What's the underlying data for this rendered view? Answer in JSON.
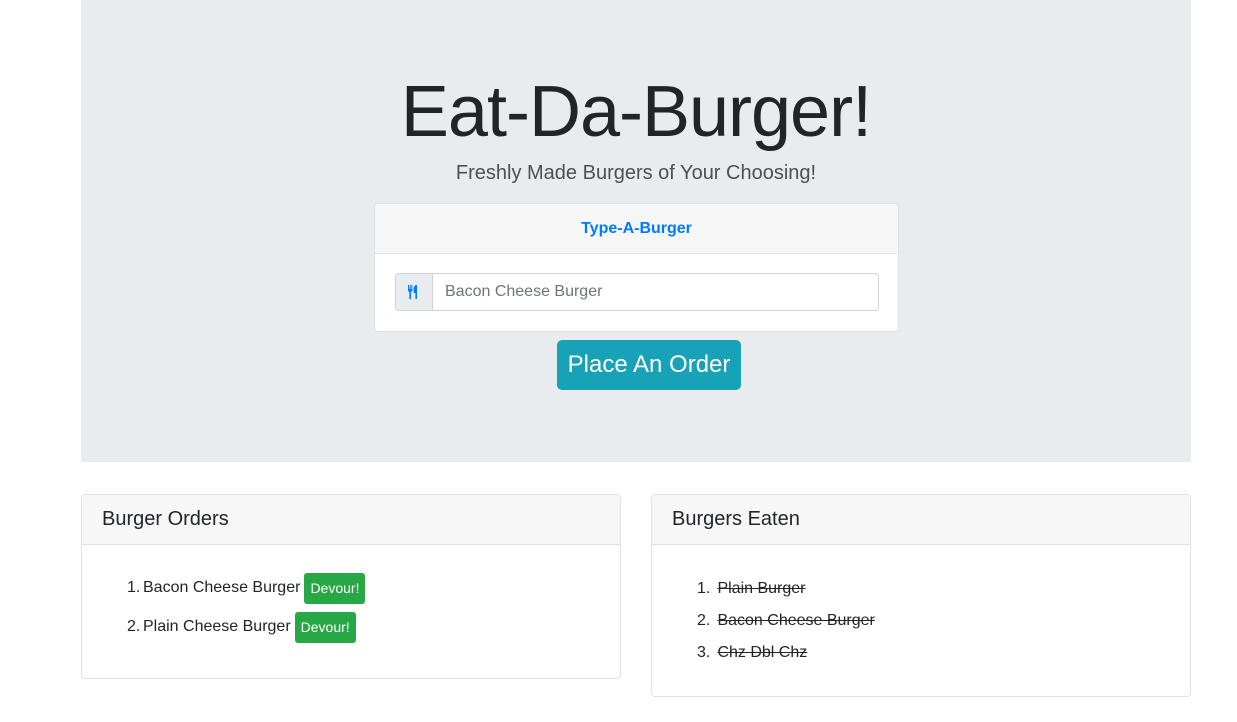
{
  "header": {
    "title": "Eat-Da-Burger!",
    "subtitle": "Freshly Made Burgers of Your Choosing!"
  },
  "order_form": {
    "card_title": "Type-A-Burger",
    "input_icon": "utensils-icon",
    "input_placeholder": "Bacon Cheese Burger",
    "input_value": "",
    "submit_label": "Place An Order"
  },
  "burger_orders": {
    "title": "Burger Orders",
    "items": [
      {
        "number": "1.",
        "name": "Bacon Cheese Burger",
        "action_label": "Devour!"
      },
      {
        "number": "2.",
        "name": "Plain Cheese Burger",
        "action_label": "Devour!"
      }
    ]
  },
  "burgers_eaten": {
    "title": "Burgers Eaten",
    "items": [
      {
        "number": "1.",
        "name": "Plain Burger"
      },
      {
        "number": "2.",
        "name": "Bacon Cheese Burger"
      },
      {
        "number": "3.",
        "name": "Chz Dbl Chz"
      }
    ]
  },
  "colors": {
    "jumbotron_bg": "#e9ecef",
    "primary_text": "#007bff",
    "order_button": "#17a2b8",
    "devour_button": "#28a745"
  }
}
